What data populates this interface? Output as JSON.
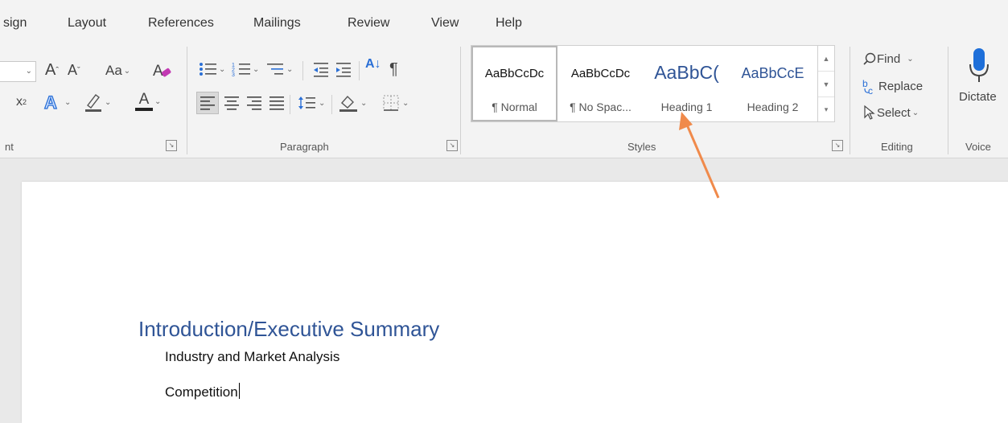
{
  "tabs": [
    "sign",
    "Layout",
    "References",
    "Mailings",
    "Review",
    "View",
    "Help"
  ],
  "font_group": {
    "label": "nt",
    "grow_font": "A",
    "shrink_font": "A",
    "change_case": "Aa",
    "superscript": "x",
    "font_color": "A"
  },
  "paragraph_group": {
    "label": "Paragraph",
    "sort": "A↓",
    "pilcrow": "¶"
  },
  "styles_group": {
    "label": "Styles",
    "tiles": [
      {
        "preview": "AaBbCcDc",
        "name": "¶ Normal"
      },
      {
        "preview": "AaBbCcDc",
        "name": "¶ No Spac..."
      },
      {
        "preview": "AaBbC(",
        "name": "Heading 1"
      },
      {
        "preview": "AaBbCcE",
        "name": "Heading 2"
      }
    ]
  },
  "editing_group": {
    "label": "Editing",
    "find": "Find",
    "replace": "Replace",
    "select": "Select"
  },
  "voice_group": {
    "label": "Voice",
    "dictate": "Dictate"
  },
  "document": {
    "heading": "Introduction/Executive Summary",
    "paragraphs": [
      "Industry and Market Analysis",
      "Competition"
    ]
  },
  "colors": {
    "heading": "#2f5496",
    "arrow": "#f08a4b",
    "dictate_icon": "#1e6fd9"
  }
}
